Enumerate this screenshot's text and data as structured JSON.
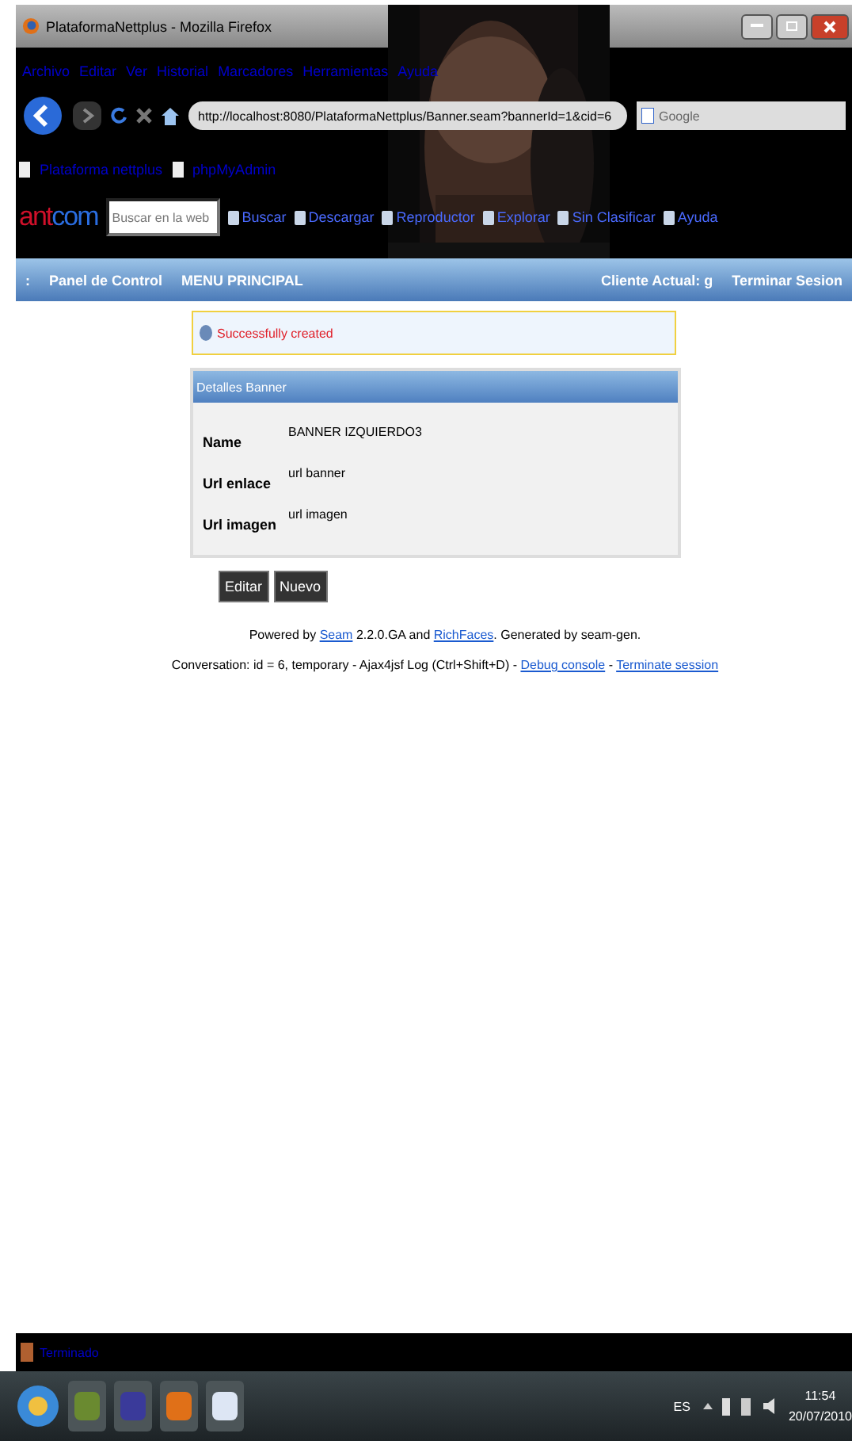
{
  "window": {
    "title": "PlataformaNettplus - Mozilla Firefox"
  },
  "menu": [
    "Archivo",
    "Editar",
    "Ver",
    "Historial",
    "Marcadores",
    "Herramientas",
    "Ayuda"
  ],
  "navigation": {
    "url": "http://localhost:8080/PlataformaNettplus/Banner.seam?bannerId=1&cid=6",
    "search_placeholder": "Google"
  },
  "bookmarks": [
    "Plataforma nettplus",
    "phpMyAdmin"
  ],
  "toolbar": {
    "brand_a": "ant",
    "brand_b": "com",
    "search_placeholder": "Buscar en la web",
    "items": [
      "Buscar",
      "Descargar",
      "Reproductor",
      "Explorar",
      "Sin Clasificar",
      "Ayuda"
    ]
  },
  "app_nav": {
    "marker": ":",
    "left": [
      "Panel de Control",
      "MENU PRINCIPAL"
    ],
    "right": [
      "Cliente Actual: g",
      "Terminar Sesion"
    ]
  },
  "message": "Successfully created",
  "panel": {
    "title": "Detalles Banner",
    "fields": [
      {
        "label": "Name",
        "value": "BANNER IZQUIERDO3"
      },
      {
        "label": "Url enlace",
        "value": "url banner"
      },
      {
        "label": "Url imagen",
        "value": "url imagen"
      }
    ]
  },
  "buttons": [
    "Editar",
    "Nuevo"
  ],
  "footer": [
    [
      {
        "text": "Powered by ",
        "link": false
      },
      {
        "text": "Seam",
        "link": true
      },
      {
        "text": " 2.2.0.GA and ",
        "link": false
      },
      {
        "text": "RichFaces",
        "link": true
      },
      {
        "text": ". Generated by seam-gen.",
        "link": false
      }
    ],
    [
      {
        "text": "Conversation: id = 6, temporary - Ajax4jsf Log (Ctrl+Shift+D) - ",
        "link": false
      },
      {
        "text": "Debug console",
        "link": true
      },
      {
        "text": " - ",
        "link": false
      },
      {
        "text": "Terminate session",
        "link": true
      }
    ]
  ],
  "status_bar": "Terminado",
  "taskbar": {
    "language": "ES",
    "time": "11:54",
    "date": "20/07/2010"
  }
}
